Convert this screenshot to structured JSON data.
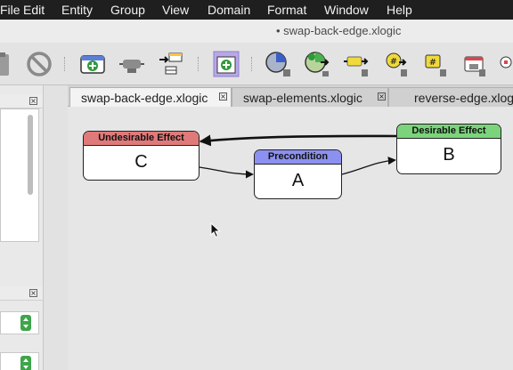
{
  "menu": {
    "items": [
      "File",
      "Edit",
      "Entity",
      "Group",
      "View",
      "Domain",
      "Format",
      "Window",
      "Help"
    ]
  },
  "window": {
    "title": "• swap-back-edge.xlogic"
  },
  "toolbar": {
    "icons": [
      "document-icon",
      "no-entry-icon",
      "add-state-icon",
      "gripper-icon",
      "insert-row-icon",
      "add-entity-icon",
      "pie-node-icon",
      "add-pie-node-icon",
      "resistor-node-icon",
      "hash-node-icon",
      "hash-note-icon",
      "lock-window-icon"
    ]
  },
  "tabs": [
    {
      "label": "swap-back-edge.xlogic",
      "active": true
    },
    {
      "label": "swap-elements.xlogic",
      "active": false
    },
    {
      "label": "reverse-edge.xlogic",
      "active": false
    }
  ],
  "diagram": {
    "nodes": [
      {
        "id": "C",
        "header": "Undesirable Effect",
        "label": "C",
        "color": "#e07a7a"
      },
      {
        "id": "A",
        "header": "Precondition",
        "label": "A",
        "color": "#8c90f0"
      },
      {
        "id": "B",
        "header": "Desirable Effect",
        "label": "B",
        "color": "#7bd47b"
      }
    ],
    "edges": [
      {
        "from": "C",
        "to": "A"
      },
      {
        "from": "A",
        "to": "B"
      },
      {
        "from": "B",
        "to": "C"
      }
    ]
  },
  "colors": {
    "accent_green": "#3ea54a",
    "menubar": "#1f1f1f"
  }
}
